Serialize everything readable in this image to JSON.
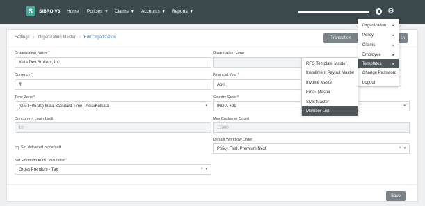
{
  "app": {
    "logo_letter": "S",
    "name": "SIBRO V3"
  },
  "nav": {
    "home": "Home",
    "policies": "Policies",
    "claims": "Claims",
    "accounts": "Accounts",
    "reports": "Reports",
    "caret": "▼"
  },
  "toolbar": {
    "progress_fraction": 1.0
  },
  "breadcrumb": {
    "settings": "Settings",
    "org_master": "Organization Master",
    "current": "Edit Organization",
    "separator": "›"
  },
  "buttons": {
    "translation": "Translation",
    "search": "ch",
    "save": "Save"
  },
  "form": {
    "org_name": {
      "label": "Organization Name",
      "value": "Yella Dev Brokers, Inc."
    },
    "org_logo": {
      "label": "Organization Logo"
    },
    "currency": {
      "label": "Currency",
      "value": "₹"
    },
    "financial_year": {
      "label": "Financial Year",
      "value": "April"
    },
    "time_zone": {
      "label": "Time Zone",
      "value": "(GMT+05:30) India Standard Time - Asia/Kolkata"
    },
    "country_code": {
      "label": "Country Code",
      "value": "INDIA +91"
    },
    "concurrent_login": {
      "label": "Concurrent Login Limit",
      "value": "10"
    },
    "max_customer": {
      "label": "Max Customer Count",
      "value": "15000"
    },
    "set_delivered": {
      "label": "Set delivered by default"
    },
    "default_workflow": {
      "label": "Default Workflow Order",
      "value": "Policy First, Premium Next"
    },
    "net_premium": {
      "label": "Net Premium Auto Calculation",
      "value": "Gross Premium - Tax"
    },
    "required_mark": "*",
    "dropdown_glyph": "▾",
    "clear_glyph": "×"
  },
  "settings_menu": {
    "items": [
      {
        "label": "Organization",
        "arrow": "▸"
      },
      {
        "label": "Policy",
        "arrow": "▸"
      },
      {
        "label": "Claims",
        "arrow": "▸"
      },
      {
        "label": "Employee",
        "arrow": "▸"
      },
      {
        "label": "Templates",
        "arrow": "▸"
      },
      {
        "label": "Change Password"
      },
      {
        "label": "Logout"
      }
    ]
  },
  "templates_menu": {
    "items": [
      {
        "label": "RFQ Template Master"
      },
      {
        "label": "Installment Payout Master"
      },
      {
        "label": "Invoice Master"
      },
      {
        "label": "Email Master"
      },
      {
        "label": "SMS Master"
      },
      {
        "label": "Member List"
      }
    ]
  },
  "colors": {
    "topbar": "#3d4a4d",
    "logo": "#4aa79a",
    "accent_link": "#4a7fa8",
    "button": "#7a8388",
    "menu_active": "#4d5659"
  }
}
